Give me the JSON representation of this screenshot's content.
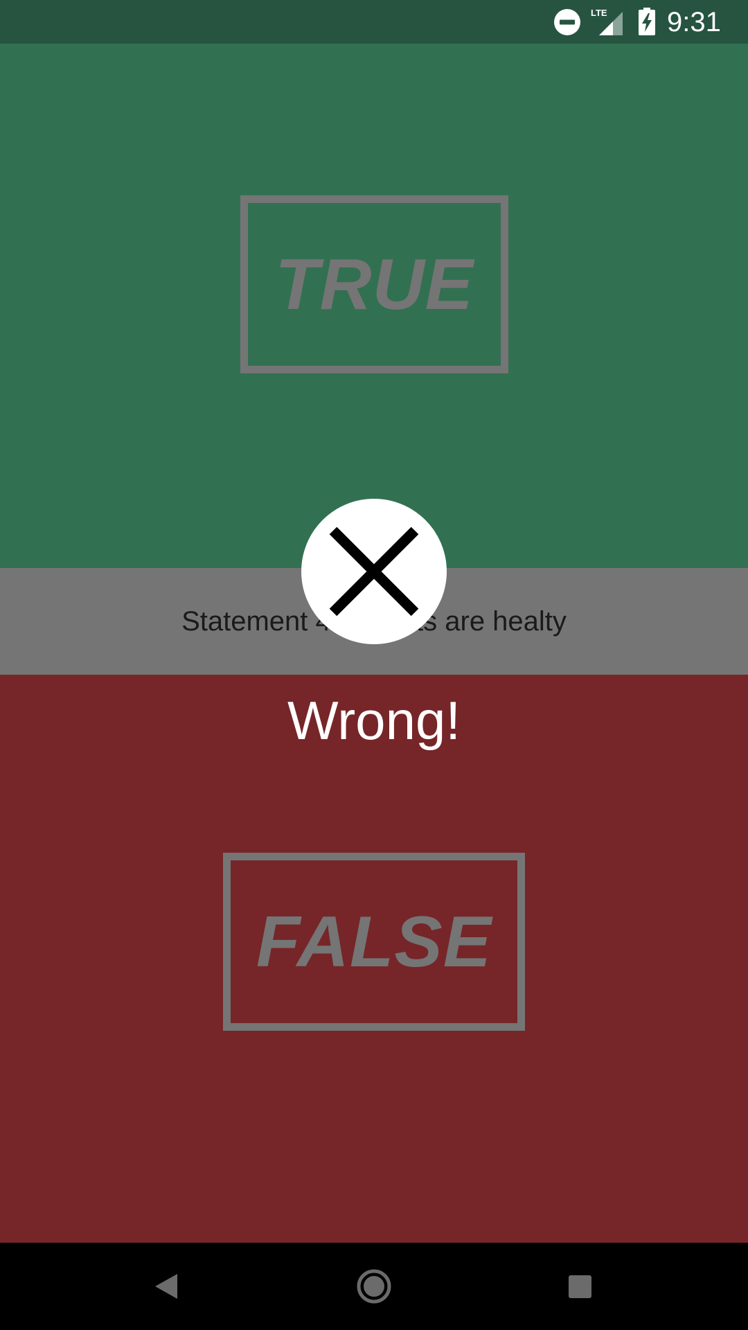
{
  "status_bar": {
    "time": "9:31",
    "network_label": "LTE",
    "icons": [
      "do-not-disturb-icon",
      "lte-signal-icon",
      "battery-charging-icon"
    ]
  },
  "quiz": {
    "true_label": "TRUE",
    "false_label": "FALSE",
    "statement": "Statement 4: Sweets are healty",
    "result_text": "Wrong!",
    "result_icon": "close-icon"
  },
  "navigation": {
    "icons": [
      "back-icon",
      "home-icon",
      "recents-icon"
    ]
  },
  "colors": {
    "true_panel": "#327052",
    "false_panel": "#762628",
    "statement_bar": "#757575",
    "status_bar": "#265440",
    "answer_border": "#757575"
  }
}
